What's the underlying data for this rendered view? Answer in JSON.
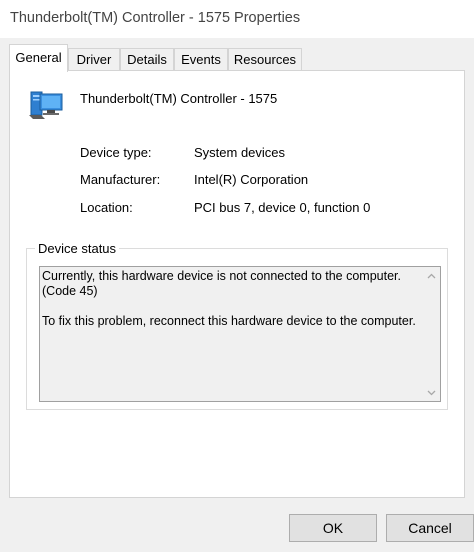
{
  "window": {
    "title": "Thunderbolt(TM) Controller - 1575 Properties"
  },
  "tabs": [
    {
      "label": "General",
      "active": true
    },
    {
      "label": "Driver",
      "active": false
    },
    {
      "label": "Details",
      "active": false
    },
    {
      "label": "Events",
      "active": false
    },
    {
      "label": "Resources",
      "active": false
    }
  ],
  "device": {
    "icon": "system-device-icon",
    "name": "Thunderbolt(TM) Controller - 1575",
    "properties": [
      {
        "label": "Device type:",
        "value": "System devices"
      },
      {
        "label": "Manufacturer:",
        "value": "Intel(R) Corporation"
      },
      {
        "label": "Location:",
        "value": "PCI bus 7, device 0, function 0"
      }
    ]
  },
  "status": {
    "legend": "Device status",
    "line1": "Currently, this hardware device is not connected to the computer. (Code 45)",
    "line2": "To fix this problem, reconnect this hardware device to the computer."
  },
  "buttons": {
    "ok": "OK",
    "cancel": "Cancel"
  }
}
